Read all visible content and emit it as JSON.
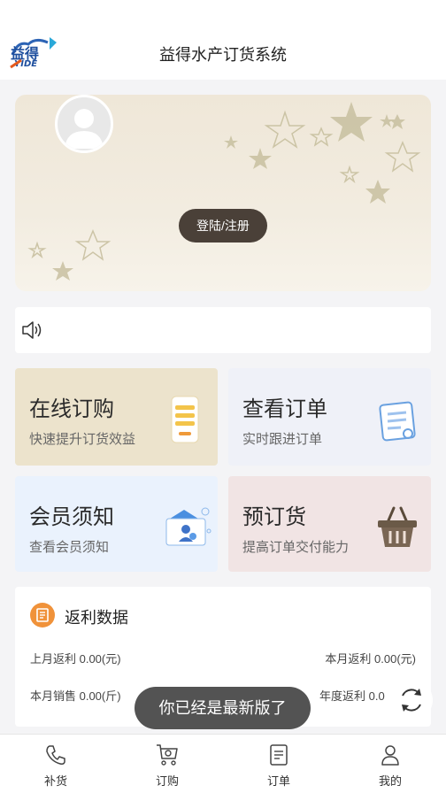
{
  "header": {
    "title": "益得水产订货系统",
    "logo_alt": "益得 YIDE"
  },
  "banner": {
    "login_label": "登陆/注册"
  },
  "notice": {
    "icon": "speaker-icon"
  },
  "cards": [
    {
      "title": "在线订购",
      "subtitle": "快速提升订货效益",
      "icon": "phone-list-icon",
      "color": "#ece3cc"
    },
    {
      "title": "查看订单",
      "subtitle": "实时跟进订单",
      "icon": "document-icon",
      "color": "#eff1f8"
    },
    {
      "title": "会员须知",
      "subtitle": "查看会员须知",
      "icon": "member-card-icon",
      "color": "#eaf2fd"
    },
    {
      "title": "预订货",
      "subtitle": "提高订单交付能力",
      "icon": "basket-icon",
      "color": "#f1e4e4"
    }
  ],
  "rebate": {
    "title": "返利数据",
    "last_month": "上月返利 0.00(元)",
    "this_month": "本月返利 0.00(元)",
    "month_sales": "本月销售 0.00(斤)",
    "year_rebate": "年度返利  0.0"
  },
  "toast": {
    "text": "你已经是最新版了"
  },
  "tabs": [
    {
      "label": "补货",
      "icon": "phone-icon"
    },
    {
      "label": "订购",
      "icon": "cart-icon"
    },
    {
      "label": "订单",
      "icon": "clipboard-icon"
    },
    {
      "label": "我的",
      "icon": "user-icon"
    }
  ]
}
